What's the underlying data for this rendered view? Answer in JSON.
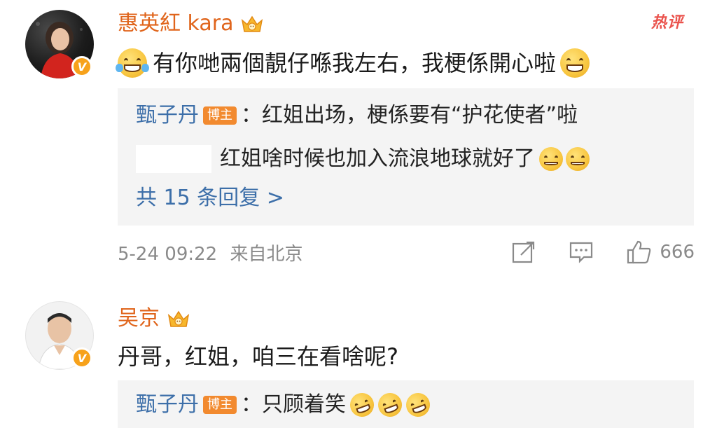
{
  "comments": [
    {
      "username": "惠英紅 kara",
      "hot_label": "热评",
      "text": "有你哋兩個靚仔喺我左右，我梗係開心啦",
      "replies": [
        {
          "user": "甄子丹",
          "tag": "博主",
          "text": "：红姐出场，梗係要有“护花使者”啦"
        },
        {
          "user": "",
          "tag": "",
          "text": "红姐啥时候也加入流浪地球就好了"
        }
      ],
      "more_replies": "共 15 条回复 >",
      "time": "5-24 09:22",
      "source": "来自北京",
      "likes": "666"
    },
    {
      "username": "吴京",
      "text": "丹哥，红姐，咱三在看啥呢?",
      "replies": [
        {
          "user": "甄子丹",
          "tag": "博主",
          "text": "：只顾着笑"
        }
      ]
    }
  ],
  "icons": {
    "verified": "verified-v-badge",
    "crown": "crown-icon",
    "share": "share-icon",
    "comment": "comment-icon",
    "like": "thumbs-up-icon"
  },
  "colors": {
    "username": "#e0651c",
    "link": "#3d6fa9",
    "blogger_tag": "#f28a2f",
    "verified": "#f7a21b",
    "hot": "#e8413a"
  }
}
